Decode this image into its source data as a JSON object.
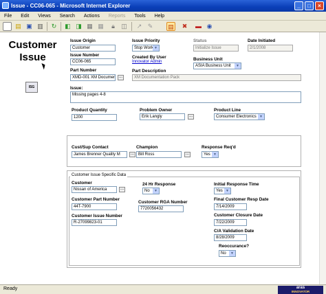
{
  "window": {
    "title": "Issue - CC06-065 - Microsoft Internet Explorer"
  },
  "menu": {
    "items": [
      {
        "label": "File",
        "enabled": true
      },
      {
        "label": "Edit",
        "enabled": true
      },
      {
        "label": "Views",
        "enabled": true
      },
      {
        "label": "Search",
        "enabled": true
      },
      {
        "label": "Actions",
        "enabled": true
      },
      {
        "label": "Reports",
        "enabled": false
      },
      {
        "label": "Tools",
        "enabled": true
      },
      {
        "label": "Help",
        "enabled": true
      }
    ]
  },
  "toolbar": {
    "icons": [
      "new-document-icon",
      "open-icon",
      "save-icon",
      "print-icon",
      "refresh-icon",
      "first-record-icon",
      "previous-record-icon",
      "next-record-icon",
      "last-record-icon",
      "lock-icon",
      "unlock-icon",
      "promote-icon",
      "attach-icon",
      "edit-form-icon",
      "delete-icon",
      "car-icon",
      "view-icon"
    ]
  },
  "page": {
    "heading": "Customer Issue",
    "doc_icon_text": "ISG"
  },
  "form": {
    "issue_origin": {
      "label": "Issue Origin",
      "value": "Customer"
    },
    "issue_priority": {
      "label": "Issue Priority",
      "value": "Stop Work"
    },
    "status": {
      "label": "Status",
      "value": "Initialize Issue"
    },
    "date_initiated": {
      "label": "Date Initiated",
      "value": "2/1/2008"
    },
    "issue_number": {
      "label": "Issue Number",
      "value": "CC06-065"
    },
    "created_by": {
      "label": "Created By User",
      "value": "Innovator Admin"
    },
    "business_unit": {
      "label": "Business Unit",
      "value": "ASIA Business Unit"
    },
    "part_number": {
      "label": "Part Number",
      "value": "XMD-001 XM Documenta"
    },
    "part_description": {
      "label": "Part Description",
      "value": "XM Documentation Pack"
    },
    "issue": {
      "label": "Issue:",
      "value": "Missing pages 4-8"
    },
    "product_quantity": {
      "label": "Product Quantity",
      "value": "1200"
    },
    "problem_owner": {
      "label": "Problem Owner",
      "value": "Erik Langly"
    },
    "product_line": {
      "label": "Product Line",
      "value": "Consumer Electronics"
    }
  },
  "contact": {
    "cust_contact": {
      "label": "Cust/Sup Contact",
      "value": "James Brenner Quality M"
    },
    "champion": {
      "label": "Champion",
      "value": "Bill Ross"
    },
    "response_reqd": {
      "label": "Response Req'd",
      "value": "Yes"
    }
  },
  "specific": {
    "legend": "Customer Issue Specific Data",
    "customer": {
      "label": "Customer",
      "value": "Nissan of America"
    },
    "hr24_response": {
      "label": "24 Hr Response",
      "value": "No"
    },
    "initial_response_time": {
      "label": "Initial Response Time",
      "value": "Yes"
    },
    "customer_part_number": {
      "label": "Customer Part Number",
      "value": "44T-7900"
    },
    "final_customer_resp_date": {
      "label": "Final Customer Resp Date",
      "value": "7/14/2009"
    },
    "customer_rga_number": {
      "label": "Customer RGA Number",
      "value": "7720056432"
    },
    "customer_issue_number": {
      "label": "Customer Issue Number",
      "value": "R-27099823-01"
    },
    "customer_closure_date": {
      "label": "Customer Closure Date",
      "value": "7/22/2009"
    },
    "ca_validation_date": {
      "label": "C/A Validation Date",
      "value": "8/28/2009"
    },
    "reoccurance": {
      "label": "Reoccurance?",
      "value": "No"
    }
  },
  "status": {
    "text": "Ready",
    "brand": "aras",
    "brand_sub": "INNOVATOR"
  }
}
